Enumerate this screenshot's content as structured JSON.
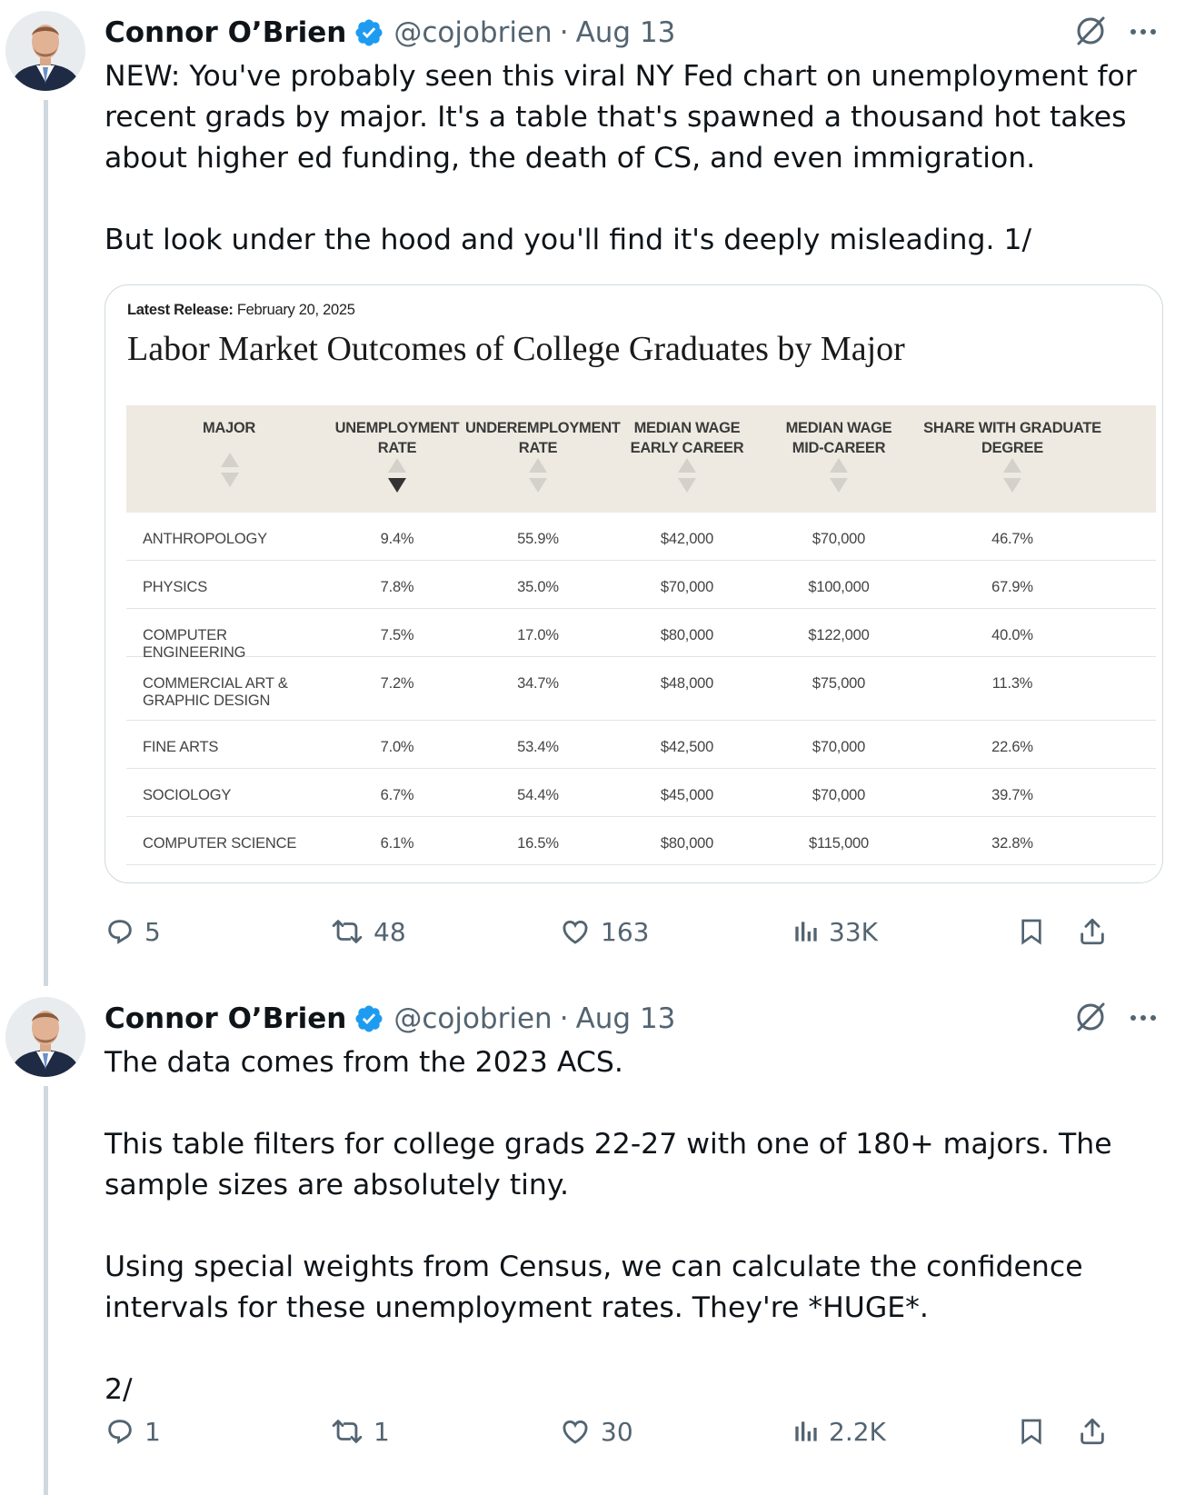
{
  "tweets": [
    {
      "author": {
        "name": "Connor O’Brien",
        "handle": "@cojobrien",
        "separator": "·",
        "date": "Aug 13",
        "verified_color": "#1d9bf0"
      },
      "text": [
        "NEW: You've probably seen this viral NY Fed chart on unemployment for recent grads by major. It's a table that's spawned a thousand hot takes about higher ed funding, the death of CS, and even immigration.",
        "But look under the hood and you'll find it's deeply misleading. 1/"
      ],
      "media": {
        "release_label": "Latest Release:",
        "release_date": "February 20, 2025",
        "title": "Labor Market Outcomes of College Graduates by Major",
        "columns": [
          "MAJOR",
          "UNEMPLOYMENT RATE",
          "UNDEREMPLOYMENT RATE",
          "MEDIAN WAGE EARLY CAREER",
          "MEDIAN WAGE MID-CAREER",
          "SHARE WITH GRADUATE DEGREE"
        ],
        "column_lines": [
          [
            "MAJOR"
          ],
          [
            "UNEMPLOYMENT",
            "RATE"
          ],
          [
            "UNDEREMPLOYMENT",
            "RATE"
          ],
          [
            "MEDIAN WAGE",
            "EARLY CAREER"
          ],
          [
            "MEDIAN WAGE",
            "MID-CAREER"
          ],
          [
            "SHARE WITH GRADUATE",
            "DEGREE"
          ]
        ],
        "sorted_column": "UNEMPLOYMENT RATE",
        "sort_direction": "descending",
        "rows": [
          {
            "major": "ANTHROPOLOGY",
            "unemployment": "9.4%",
            "underemployment": "55.9%",
            "early": "$42,000",
            "mid": "$70,000",
            "grad": "46.7%"
          },
          {
            "major": "PHYSICS",
            "unemployment": "7.8%",
            "underemployment": "35.0%",
            "early": "$70,000",
            "mid": "$100,000",
            "grad": "67.9%"
          },
          {
            "major": "COMPUTER ENGINEERING",
            "unemployment": "7.5%",
            "underemployment": "17.0%",
            "early": "$80,000",
            "mid": "$122,000",
            "grad": "40.0%"
          },
          {
            "major": "COMMERCIAL ART & GRAPHIC DESIGN",
            "major_lines": [
              "COMMERCIAL ART &",
              "GRAPHIC DESIGN"
            ],
            "unemployment": "7.2%",
            "underemployment": "34.7%",
            "early": "$48,000",
            "mid": "$75,000",
            "grad": "11.3%"
          },
          {
            "major": "FINE ARTS",
            "unemployment": "7.0%",
            "underemployment": "53.4%",
            "early": "$42,500",
            "mid": "$70,000",
            "grad": "22.6%"
          },
          {
            "major": "SOCIOLOGY",
            "unemployment": "6.7%",
            "underemployment": "54.4%",
            "early": "$45,000",
            "mid": "$70,000",
            "grad": "39.7%"
          },
          {
            "major": "COMPUTER SCIENCE",
            "unemployment": "6.1%",
            "underemployment": "16.5%",
            "early": "$80,000",
            "mid": "$115,000",
            "grad": "32.8%"
          }
        ]
      },
      "stats": {
        "replies": "5",
        "reposts": "48",
        "likes": "163",
        "views": "33K"
      }
    },
    {
      "author": {
        "name": "Connor O’Brien",
        "handle": "@cojobrien",
        "separator": "·",
        "date": "Aug 13"
      },
      "text": [
        "The data comes from the 2023 ACS.",
        "This table filters for college grads 22-27 with one of 180+ majors. The sample sizes are absolutely tiny.",
        "Using special weights from Census, we can calculate the confidence intervals for these unemployment rates. They're *HUGE*.",
        "2/"
      ],
      "stats": {
        "replies": "1",
        "reposts": "1",
        "likes": "30",
        "views": "2.2K"
      }
    }
  ],
  "icons": {
    "verified": "verified-badge-icon",
    "grok": "grok-icon",
    "more": "more-options-icon",
    "reply": "reply-icon",
    "repost": "repost-icon",
    "like": "like-icon",
    "views": "views-icon",
    "bookmark": "bookmark-icon",
    "share": "share-icon"
  },
  "colors": {
    "text": "#0f1419",
    "secondary": "#536471",
    "verified": "#1d9bf0",
    "thread_line": "#cfd9de",
    "table_header_bg": "#eeeae2"
  }
}
